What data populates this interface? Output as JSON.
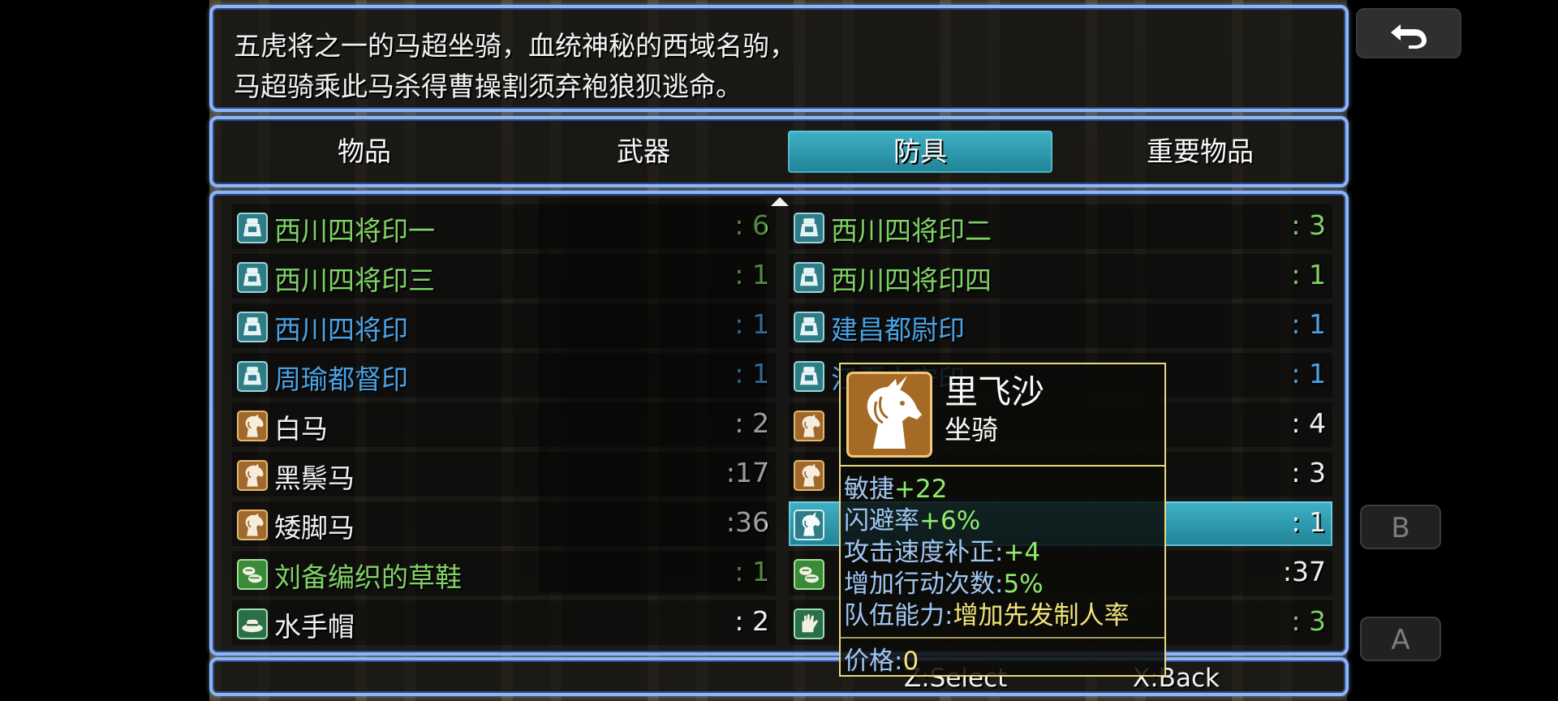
{
  "help": {
    "line1": "五虎将之一的马超坐骑，血统神秘的西域名驹，",
    "line2": "马超骑乘此马杀得曹操割须弃袍狼狈逃命。"
  },
  "categories": [
    {
      "label": "物品"
    },
    {
      "label": "武器"
    },
    {
      "label": "防具",
      "selected": true
    },
    {
      "label": "重要物品"
    }
  ],
  "items": [
    {
      "name": "西川四将印一",
      "count": ":  6",
      "color": "#7fd266",
      "icon": "seal-icon"
    },
    {
      "name": "西川四将印二",
      "count": ":  3",
      "color": "#7fd266",
      "icon": "seal-icon"
    },
    {
      "name": "西川四将印三",
      "count": ":  1",
      "color": "#7fd266",
      "icon": "seal-icon"
    },
    {
      "name": "西川四将印四",
      "count": ":  1",
      "color": "#7fd266",
      "icon": "seal-icon"
    },
    {
      "name": "西川四将印",
      "count": ":  1",
      "color": "#4aa2e4",
      "icon": "seal-icon"
    },
    {
      "name": "建昌都尉印",
      "count": ":  1",
      "color": "#4aa2e4",
      "icon": "seal-icon"
    },
    {
      "name": "周瑜都督印",
      "count": ":  1",
      "color": "#4aa2e4",
      "icon": "seal-icon"
    },
    {
      "name": "江夏太守印",
      "count": ":  1",
      "color": "#4aa2e4",
      "icon": "seal-icon"
    },
    {
      "name": "白马",
      "count": ":  2",
      "color": "#f0f0f0",
      "icon": "horse-icon"
    },
    {
      "name": "",
      "count": ":  4",
      "color": "#f0f0f0",
      "icon": "horse-icon"
    },
    {
      "name": "黑鬃马",
      "count": ":17",
      "color": "#f0f0f0",
      "icon": "horse-icon"
    },
    {
      "name": "",
      "count": ":  3",
      "color": "#f0f0f0",
      "icon": "horse-icon"
    },
    {
      "name": "矮脚马",
      "count": ":36",
      "color": "#f0f0f0",
      "icon": "horse-icon"
    },
    {
      "name": "",
      "count": ":  1",
      "color": "#f0f0f0",
      "icon": "unicorn-icon",
      "selected": true
    },
    {
      "name": "刘备编织的草鞋",
      "count": ":  1",
      "color": "#7fd266",
      "icon": "shoes-icon"
    },
    {
      "name": "",
      "count": ":37",
      "color": "#f0f0f0",
      "icon": "shoes-icon"
    },
    {
      "name": "水手帽",
      "count": ":  2",
      "color": "#f0f0f0",
      "icon": "hat-icon"
    },
    {
      "name": "",
      "count": ":  3",
      "color": "#7fd266",
      "icon": "glove-icon"
    }
  ],
  "detail": {
    "name": "里飞沙",
    "type": "坐骑",
    "icon": "unicorn-icon",
    "stats": [
      {
        "label": "敏捷",
        "value": "+22",
        "tone": "green"
      },
      {
        "label": "闪避率",
        "value": "+6%",
        "tone": "green"
      },
      {
        "label": "攻击速度补正:",
        "value": "+4",
        "tone": "green"
      },
      {
        "label": "增加行动次数:",
        "value": "5%",
        "tone": "green"
      },
      {
        "label": "队伍能力:",
        "value": "增加先发制人率",
        "tone": "yellow"
      }
    ],
    "price_label": "价格:",
    "price_value": "0"
  },
  "key_hints": {
    "select": "Z:Select",
    "back": "X:Back"
  },
  "side_buttons": {
    "back_icon": "return-arrow-icon",
    "b": "B",
    "a": "A"
  }
}
